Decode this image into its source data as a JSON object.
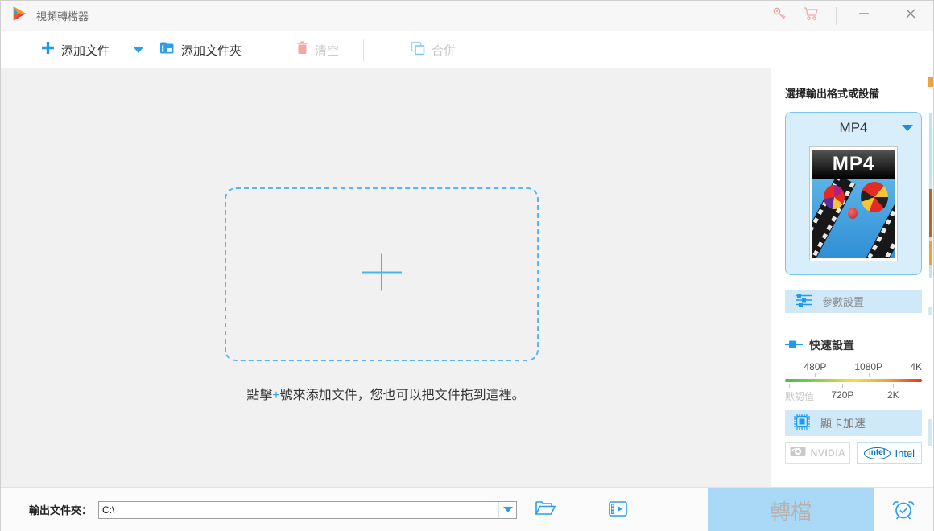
{
  "titlebar": {
    "app_title": "視頻轉檔器",
    "icons": [
      "app-logo",
      "key-icon",
      "cart-icon",
      "minimize-icon",
      "close-icon"
    ]
  },
  "toolbar": {
    "add_file": "添加文件",
    "add_folder": "添加文件夾",
    "clear": "清空",
    "merge": "合併"
  },
  "dropzone": {
    "hint_prefix": "點擊",
    "hint_plus": "+",
    "hint_suffix": "號來添加文件，您也可以把文件拖到這裡。"
  },
  "sidebar": {
    "header": "選擇輸出格式或設備",
    "format_selected": "MP4",
    "thumb_label": "MP4",
    "param_settings": "參數設置",
    "quick_settings": "快速設置",
    "slider": {
      "top_labels": [
        "480P",
        "1080P",
        "4K"
      ],
      "bottom_labels": [
        "默認值",
        "720P",
        "2K"
      ],
      "gradient": [
        "#3cc24e",
        "#f2e04a",
        "#e3342a"
      ]
    },
    "gpu_accel": "顯卡加速",
    "nvidia_label": "NVIDIA",
    "intel_logo": "intel",
    "intel_label": "Intel"
  },
  "footer": {
    "output_label": "輸出文件夾：",
    "output_path": "C:\\",
    "convert": "轉檔"
  },
  "colors": {
    "accent_blue": "#2d9fea",
    "panel_blue": "#d9eefb",
    "panel_border": "#79c6f1",
    "button_blue_bg": "#cfe9f8",
    "convert_bg": "#a9d9f6",
    "pink_icon": "#f2a7a7",
    "intel_blue": "#0a6fb8"
  }
}
